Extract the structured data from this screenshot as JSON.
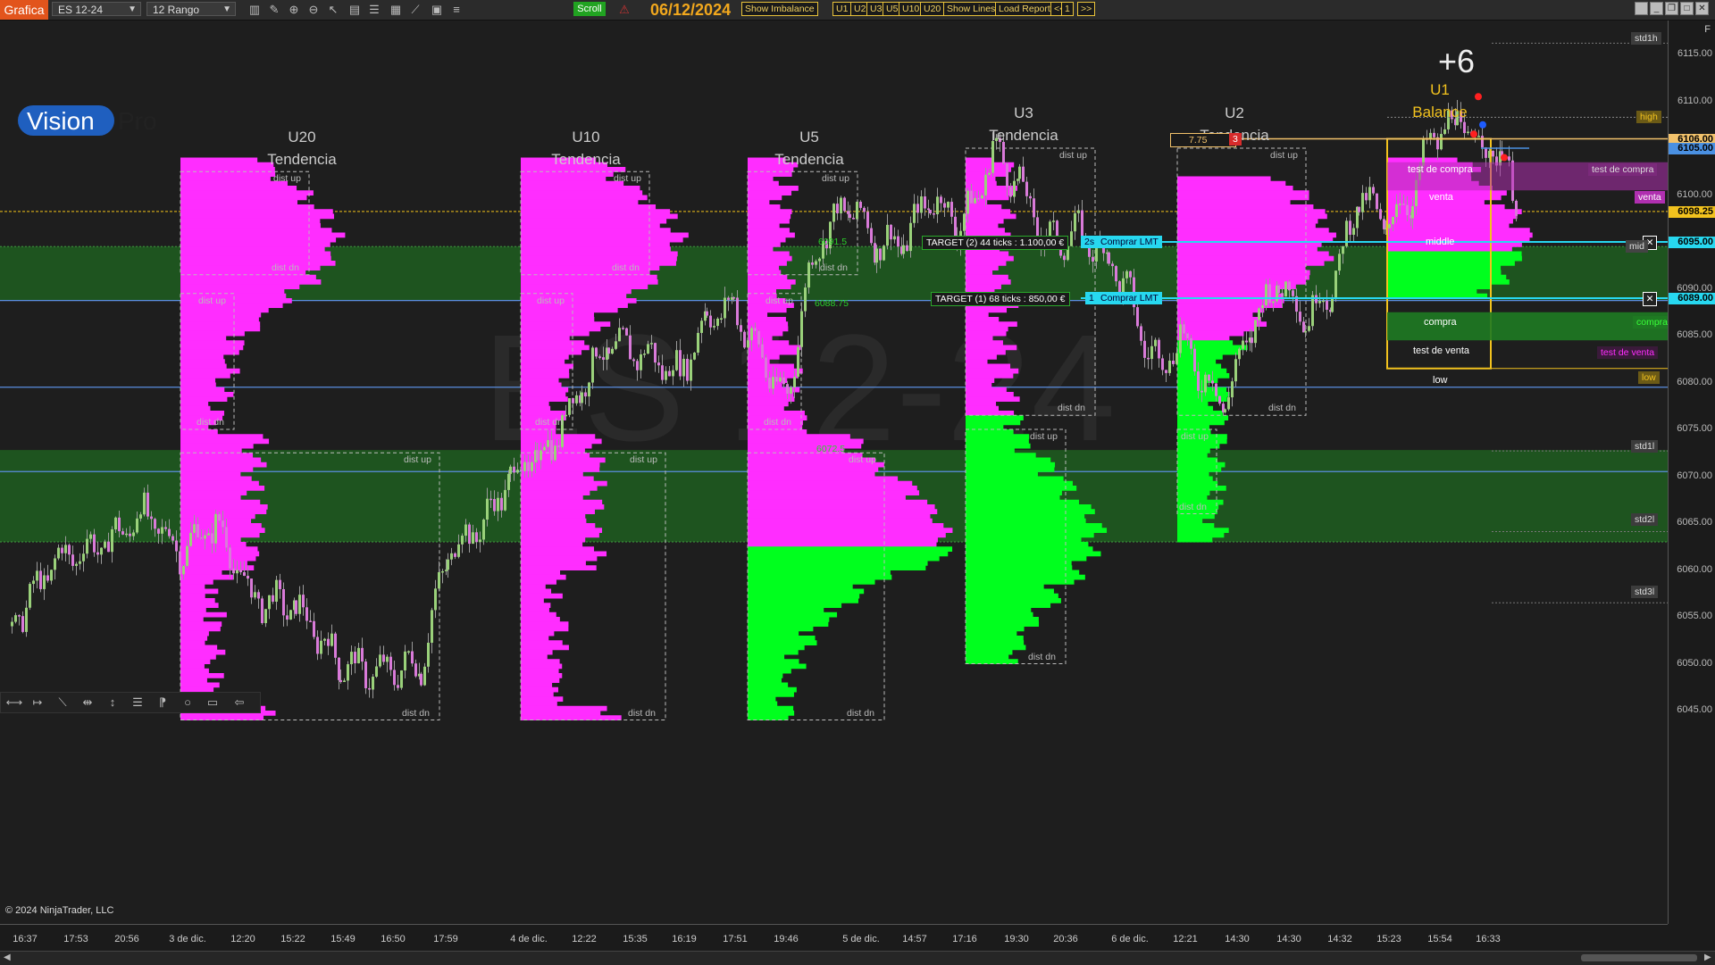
{
  "toolbar": {
    "tab": "Grafica",
    "instrument": "ES 12-24",
    "bar_type": "12 Rango",
    "scroll_label": "Scroll",
    "date": "06/12/2024",
    "buttons": [
      "Show Imbalance",
      "U1",
      "U2",
      "U3",
      "U5",
      "U10",
      "U20",
      "Show Lines",
      "Load Report",
      "<<",
      "1",
      ">>"
    ]
  },
  "chart": {
    "watermark": "ES 12-24",
    "score": "+6",
    "copyright": "© 2024 NinjaTrader, LLC",
    "logo": {
      "vision": "Vision",
      "pro": "Pro"
    },
    "profiles": [
      {
        "id": "U20",
        "name": "U20",
        "state": "Tendencia"
      },
      {
        "id": "U10",
        "name": "U10",
        "state": "Tendencia"
      },
      {
        "id": "U5",
        "name": "U5",
        "state": "Tendencia"
      },
      {
        "id": "U3",
        "name": "U3",
        "state": "Tendencia"
      },
      {
        "id": "U2",
        "name": "U2",
        "state": "Tendencia"
      },
      {
        "id": "U1",
        "name": "U1",
        "state": "Balance"
      }
    ],
    "dist_labels": {
      "up": "dist up",
      "dn": "dist dn"
    },
    "balance_box": {
      "test_compra": "test de compra",
      "venta": "venta",
      "middle": "middle",
      "compra": "compra",
      "test_venta": "test de venta",
      "low": "low",
      "high": "high"
    },
    "orders": [
      {
        "target": "TARGET (2) 44 ticks : 1.100,00 €",
        "qty": "2s",
        "action": "Comprar LMT"
      },
      {
        "target": "TARGET (1) 68 ticks : 850,00 €",
        "qty": "1",
        "action": "Comprar LMT"
      }
    ],
    "stop_box": {
      "value": "7.75",
      "qty": "3"
    },
    "level_labels": {
      "l1": "6091.5",
      "l2": "6088.75",
      "l3": "6072.5"
    }
  },
  "price_axis": {
    "ticks": [
      "6115.00",
      "6110.00",
      "6105.00",
      "6100.00",
      "6095.00",
      "6090.00",
      "6085.00",
      "6080.00",
      "6075.00",
      "6070.00",
      "6065.00",
      "6060.00",
      "6055.00",
      "6050.00",
      "6045.00"
    ],
    "tags": [
      {
        "label": "6106.00",
        "color": "#f2c26b"
      },
      {
        "label": "6105.00",
        "color": "#4a90e2"
      },
      {
        "label": "6098.25",
        "color": "#f2c21e"
      },
      {
        "label": "6095.00",
        "color": "#27d8f0"
      },
      {
        "label": "6089.00",
        "color": "#27d8f0"
      }
    ],
    "std_labels": [
      "std1h",
      "std1l",
      "std2l",
      "std3l"
    ],
    "right_labels": {
      "high": "high",
      "test_compra": "test de compra",
      "venta": "venta",
      "compra": "compra",
      "test_venta": "test de venta",
      "low": "low",
      "mid": "mid"
    },
    "corner": "F"
  },
  "time_axis": {
    "labels": [
      "16:37",
      "17:53",
      "20:56",
      "3 de dic.",
      "12:20",
      "15:22",
      "15:49",
      "16:50",
      "17:59",
      "4 de dic.",
      "12:22",
      "15:35",
      "16:19",
      "17:51",
      "19:46",
      "5 de dic.",
      "14:57",
      "17:16",
      "19:30",
      "20:36",
      "6 de dic.",
      "12:21",
      "14:30",
      "14:30",
      "14:32",
      "15:23",
      "15:54",
      "16:33"
    ]
  },
  "colors": {
    "accent": "#e2541c",
    "magenta": "#ff2dff",
    "green": "#00ff1e",
    "zone_green": "#1f5e20",
    "gold": "#f2c21e",
    "cyan": "#27d8f0"
  }
}
